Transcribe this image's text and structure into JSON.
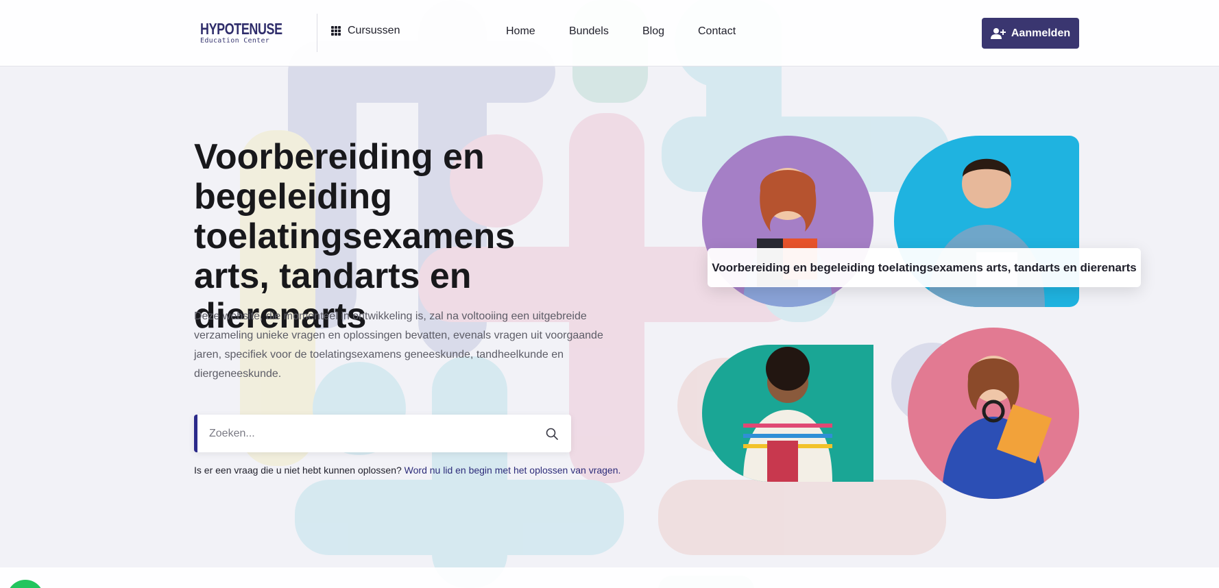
{
  "brand": {
    "name": "HYPOTENUSE",
    "tagline": "Education Center"
  },
  "header": {
    "courses_label": "Cursussen",
    "nav": [
      {
        "label": "Home"
      },
      {
        "label": "Bundels"
      },
      {
        "label": "Blog"
      },
      {
        "label": "Contact"
      }
    ],
    "signup_label": "Aanmelden"
  },
  "hero": {
    "title": "Voorbereiding en begeleiding toelatingsexamens arts, tandarts en dierenarts",
    "description": "Deze website, die momenteel in ontwikkeling is, zal na voltooiing een uitgebreide verzameling unieke vragen en oplossingen bevatten, evenals vragen uit voorgaande jaren, specifiek voor de toelatingsexamens geneeskunde, tandheelkunde en diergeneeskunde.",
    "search_placeholder": "Zoeken...",
    "note_text": "Is er een vraag die u niet hebt kunnen oplossen?",
    "note_link": "Word nu lid en begin met het oplossen van vragen."
  },
  "photos": {
    "caption": "Voorbereiding en begeleiding toelatingsexamens arts, tandarts en dierenarts",
    "backgrounds": [
      "#a57fc6",
      "#1fb3e0",
      "#1aa695",
      "#e27a92"
    ]
  },
  "colors": {
    "accent": "#3a3670",
    "link": "#2d2c7a",
    "chat": "#22c55e"
  }
}
